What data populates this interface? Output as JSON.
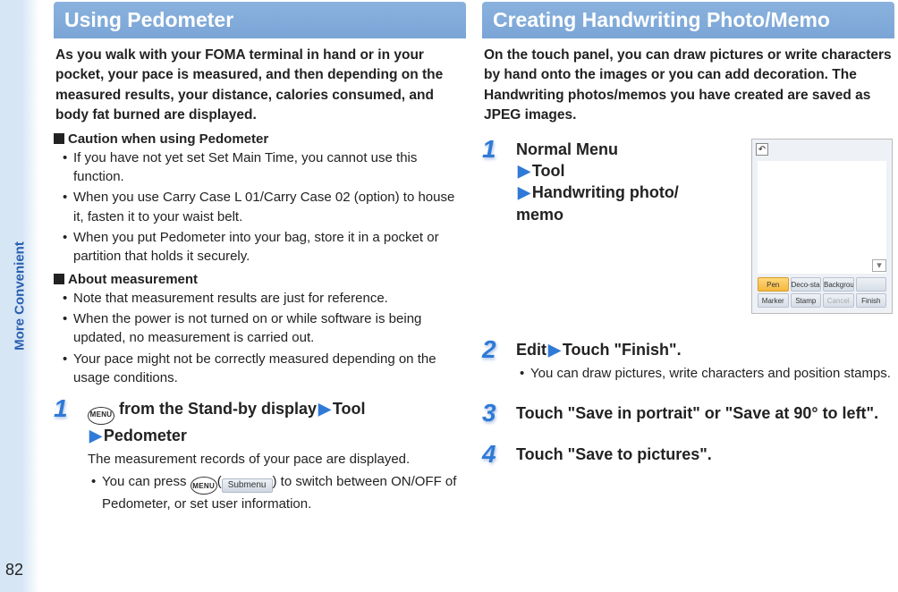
{
  "rail": {
    "label": "More Convenient"
  },
  "page_number": "82",
  "left": {
    "title": "Using Pedometer",
    "intro": "As you walk with your FOMA terminal in hand or in your pocket, your pace is measured, and then depending on the measured results, your distance, calories consumed, and body fat burned are displayed.",
    "caution_head": "Caution when using Pedometer",
    "caution_items": [
      "If you have not yet set Set Main Time, you cannot use this function.",
      "When you use Carry Case L 01/Carry Case 02 (option) to house it, fasten it to your waist belt.",
      "When you put Pedometer into your bag, store it in a pocket or partition that holds it securely."
    ],
    "about_head": "About measurement",
    "about_items": [
      "Note that measurement results are just for reference.",
      "When the power is not turned on or while software is being updated, no measurement is carried out.",
      "Your pace might not be correctly measured depending on the usage conditions."
    ],
    "step1": {
      "num": "1",
      "menu_chip": "MENU",
      "part_a": " from the Stand-by display",
      "arrow": "▶",
      "part_b": "Tool",
      "part_c": "Pedometer",
      "desc": "The measurement records of your pace are displayed.",
      "note_prefix": "You can press ",
      "submenu_chip": "Submenu",
      "note_suffix": " to switch between ON/OFF of Pedometer, or set user information."
    }
  },
  "right": {
    "title": "Creating Handwriting Photo/Memo",
    "intro": "On the touch panel, you can draw pictures or write characters by hand onto the images or you can add decoration. The Handwriting photos/memos you have created are saved as JPEG images.",
    "step1": {
      "num": "1",
      "line1": "Normal Menu",
      "arrow": "▶",
      "line2": "Tool",
      "line3a": "Handwriting photo/",
      "line3b": "memo"
    },
    "device": {
      "top_icon": "↶",
      "caret": "▾",
      "buttons_row1": [
        "Pen",
        "Deco-stamp",
        "Background",
        ""
      ],
      "buttons_row2": [
        "Marker",
        "Stamp",
        "Cancel",
        "Finish"
      ]
    },
    "step2": {
      "num": "2",
      "title_a": "Edit",
      "arrow": "▶",
      "title_b": "Touch \"Finish\".",
      "note": "You can draw pictures, write characters and position stamps."
    },
    "step3": {
      "num": "3",
      "title": "Touch \"Save in portrait\" or \"Save at 90° to left\"."
    },
    "step4": {
      "num": "4",
      "title": "Touch \"Save to pictures\"."
    }
  }
}
